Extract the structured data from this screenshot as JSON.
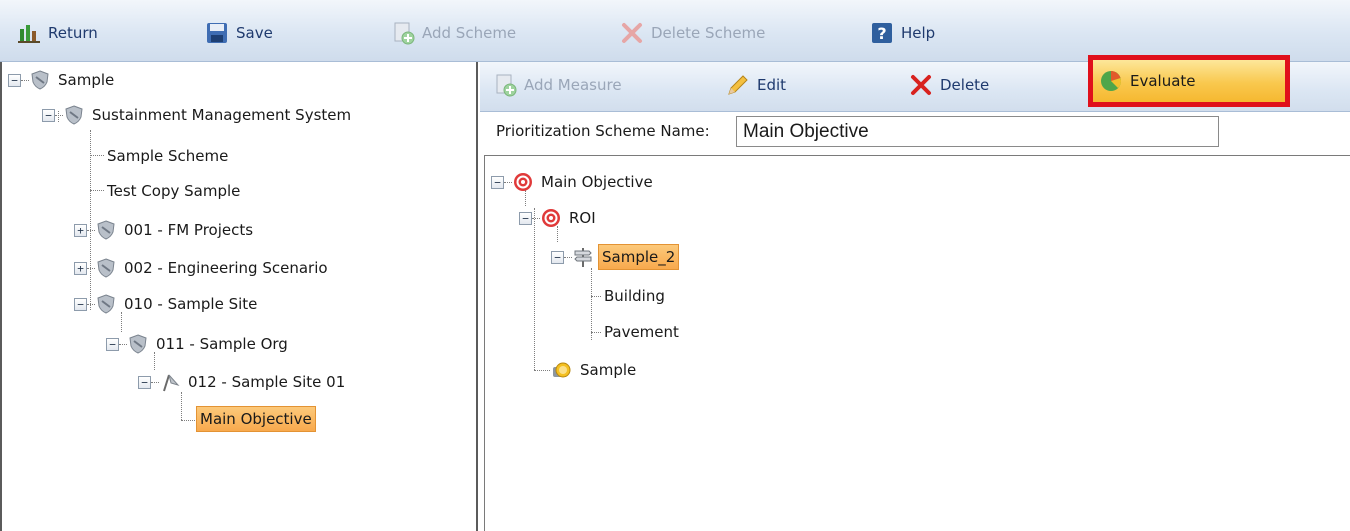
{
  "toolbar": {
    "return_label": "Return",
    "save_label": "Save",
    "add_scheme_label": "Add Scheme",
    "delete_scheme_label": "Delete Scheme",
    "help_label": "Help"
  },
  "left_tree": {
    "root": "Sample",
    "sms": "Sustainment Management System",
    "sample_scheme": "Sample Scheme",
    "test_copy": "Test Copy Sample",
    "fm_projects": "001 - FM Projects",
    "eng_scenario": "002 - Engineering Scenario",
    "sample_site": "010 - Sample Site",
    "sample_org": "011 - Sample Org",
    "sample_site_01": "012 - Sample Site 01",
    "main_objective": "Main Objective"
  },
  "right_toolbar": {
    "add_measure_label": "Add Measure",
    "edit_label": "Edit",
    "delete_label": "Delete",
    "evaluate_label": "Evaluate"
  },
  "scheme": {
    "name_label": "Prioritization Scheme Name:",
    "name_value": "Main Objective"
  },
  "right_tree": {
    "main_objective": "Main Objective",
    "roi": "ROI",
    "sample_2": "Sample_2",
    "building": "Building",
    "pavement": "Pavement",
    "sample": "Sample"
  },
  "colors": {
    "highlight_border": "#e0101b",
    "selection": "#f8a94d",
    "toolbar_text": "#1f3a6e"
  }
}
